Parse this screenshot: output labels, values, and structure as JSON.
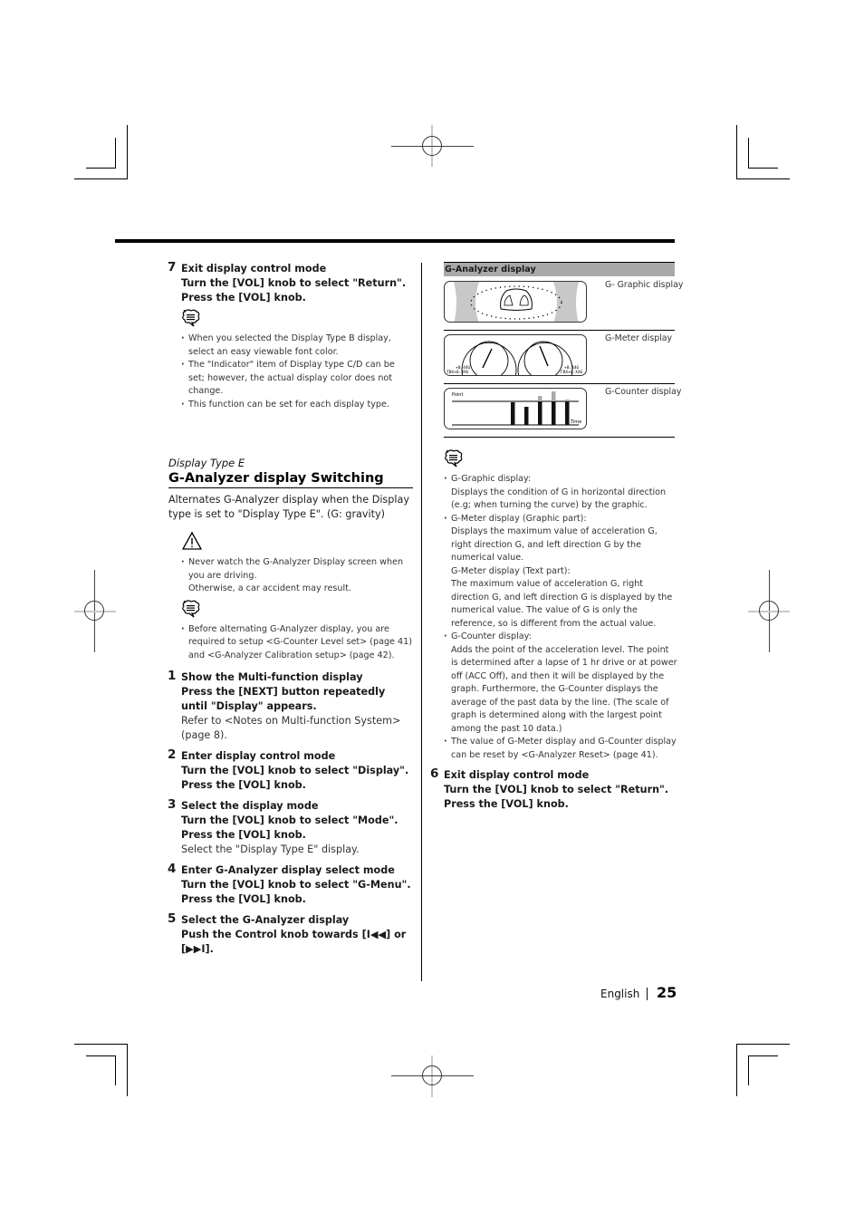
{
  "left_column": {
    "step7": {
      "number": "7",
      "title": "Exit display control mode",
      "lines": [
        "Turn the [VOL] knob to select \"Return\".",
        "Press the [VOL] knob."
      ],
      "notes": [
        "When you selected the Display Type B display, select an easy viewable font color.",
        "The \"Indicator\" item of Display type C/D can be set; however, the actual display color does not change.",
        "This function can be set for each display type."
      ]
    },
    "section": {
      "subheading": "Display Type E",
      "heading": "G-Analyzer display Switching",
      "intro": "Alternates G-Analyzer display when the Display type is set to \"Display Type E\". (G: gravity)",
      "warning": [
        "Never watch the G-Analyzer Display screen when you are driving.",
        "Otherwise, a car accident may result."
      ],
      "note": "Before alternating G-Analyzer display, you are required to setup <G-Counter Level set> (page 41) and <G-Analyzer Calibration setup> (page 42)."
    },
    "steps": [
      {
        "number": "1",
        "title": "Show the Multi-function display",
        "lines": [
          "Press the [NEXT] button repeatedly until \"Display\" appears."
        ],
        "plain": "Refer to <Notes on Multi-function System> (page 8)."
      },
      {
        "number": "2",
        "title": "Enter display control mode",
        "lines": [
          "Turn the [VOL] knob to select \"Display\".",
          "Press the [VOL] knob."
        ],
        "plain": ""
      },
      {
        "number": "3",
        "title": "Select the display mode",
        "lines": [
          "Turn the [VOL] knob to select \"Mode\".",
          "Press the [VOL] knob."
        ],
        "plain": "Select the \"Display Type E\" display."
      },
      {
        "number": "4",
        "title": "Enter G-Analyzer display select mode",
        "lines": [
          "Turn the [VOL] knob to select \"G-Menu\".",
          "Press the [VOL] knob."
        ],
        "plain": ""
      },
      {
        "number": "5",
        "title": "Select the G-Analyzer display",
        "lines": [
          "Push the Control knob towards [I◀◀] or [▶▶I]."
        ],
        "plain": ""
      }
    ]
  },
  "right_column": {
    "table_header": "G-Analyzer display",
    "displays": [
      {
        "label": "G- Graphic display",
        "icon": "g-graphic-display-illustration"
      },
      {
        "label": "G-Meter display",
        "icon": "g-meter-display-illustration",
        "readouts_left": [
          "+0.44G",
          "TBX+0.49G"
        ],
        "readouts_right": [
          "+0.44G",
          "FBX+0.XXG"
        ]
      },
      {
        "label": "G-Counter display",
        "icon": "g-counter-display-illustration",
        "axis_y": "Point",
        "axis_x": "Time"
      }
    ],
    "notes": [
      {
        "head": "G-Graphic display:",
        "body": [
          "Displays the condition of G in horizontal direction (e.g; when turning the curve) by the graphic."
        ]
      },
      {
        "head": "G-Meter display (Graphic part):",
        "body": [
          "Displays the maximum value of acceleration G, right direction G, and left direction G by the numerical value.",
          "G-Meter display (Text part):",
          "The maximum value of acceleration G, right direction G, and left direction G is displayed by the numerical value. The value of G is only the reference, so is different from the actual value."
        ]
      },
      {
        "head": "G-Counter display:",
        "body": [
          "Adds the point of the acceleration level. The point is determined after a lapse of 1 hr drive or at power off (ACC Off), and then it will be displayed by the graph. Furthermore, the G-Counter displays the average of the past data by the line. (The scale of graph is determined along with the largest point among the past 10 data.)"
        ]
      },
      {
        "head": "The value of G-Meter display and G-Counter display can be reset by <G-Analyzer Reset> (page 41).",
        "body": []
      }
    ],
    "step6": {
      "number": "6",
      "title": "Exit display control mode",
      "lines": [
        "Turn the [VOL] knob to select \"Return\".",
        "Press the [VOL] knob."
      ]
    }
  },
  "footer": {
    "language": "English",
    "page_number": "25"
  }
}
